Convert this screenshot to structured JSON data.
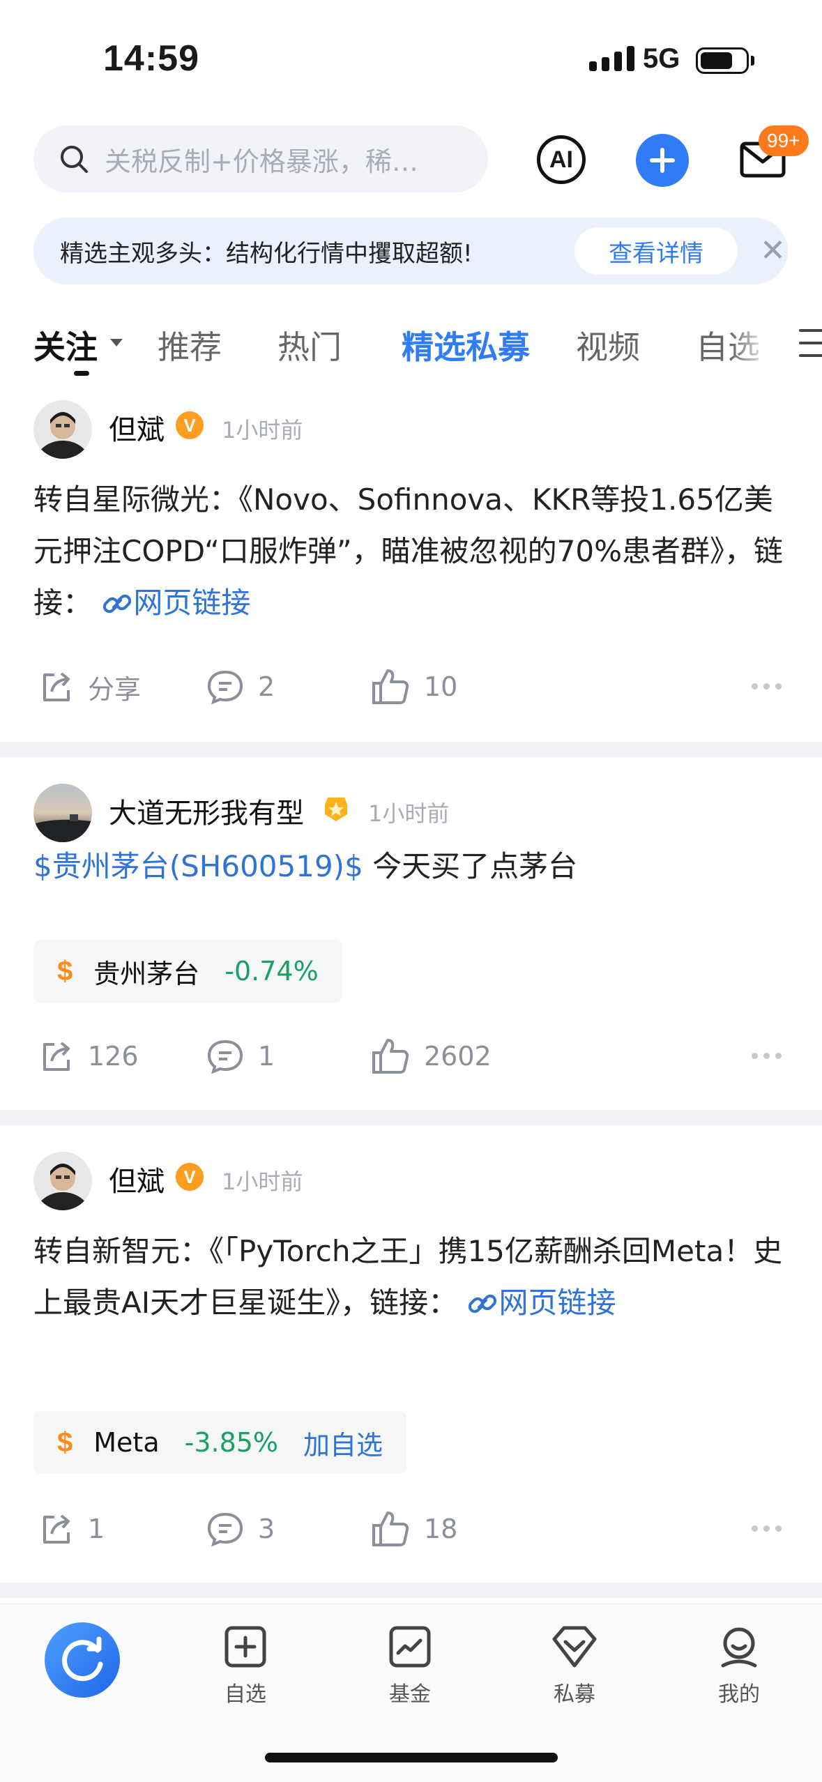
{
  "status_bar": {
    "time": "14:59",
    "network": "5G"
  },
  "header": {
    "search_placeholder": "关税反制+价格暴涨，稀…",
    "ai_label": "AI",
    "mail_badge": "99+"
  },
  "banner": {
    "text": "精选主观多头：结构化行情中攫取超额!",
    "button": "查看详情",
    "close": "✕"
  },
  "tabs": [
    {
      "label": "关注"
    },
    {
      "label": "推荐"
    },
    {
      "label": "热门"
    },
    {
      "label": "精选私募"
    },
    {
      "label": "视频"
    },
    {
      "label": "自选"
    }
  ],
  "posts": [
    {
      "author": "但斌",
      "badge": "V",
      "time": "1小时前",
      "content": "转自星际微光：《Novo、Sofinnova、KKR等投1.65亿美元押注COPD“口服炸弹”，瞄准被忽视的70%患者群》，链接：",
      "link": "网页链接",
      "share": "分享",
      "comments": "2",
      "likes": "10"
    },
    {
      "author": "大道无形我有型",
      "time": "1小时前",
      "stock_tag": "$贵州茅台(SH600519)$",
      "content": " 今天买了点茅台",
      "stock": {
        "symbol": "$",
        "name": "贵州茅台",
        "change": "-0.74%"
      },
      "share": "126",
      "comments": "1",
      "likes": "2602"
    },
    {
      "author": "但斌",
      "badge": "V",
      "time": "1小时前",
      "content": "转自新智元：《「PyTorch之王」携15亿薪酬杀回Meta！史上最贵AI天才巨星诞生》，链接：",
      "link": "网页链接",
      "stock": {
        "symbol": "$",
        "name": "Meta",
        "change": "-3.85%",
        "add": "加自选"
      },
      "share": "1",
      "comments": "3",
      "likes": "18"
    }
  ],
  "bottom_nav": [
    {
      "label": "自选",
      "icon": "plus-square-icon"
    },
    {
      "label": "基金",
      "icon": "chart-icon"
    },
    {
      "label": "私募",
      "icon": "diamond-icon"
    },
    {
      "label": "我的",
      "icon": "user-icon"
    }
  ],
  "colors": {
    "accent": "#2f7cf6",
    "link": "#2f73d9",
    "up_down_green": "#1aa064",
    "badge_orange": "#ff7a1a"
  }
}
